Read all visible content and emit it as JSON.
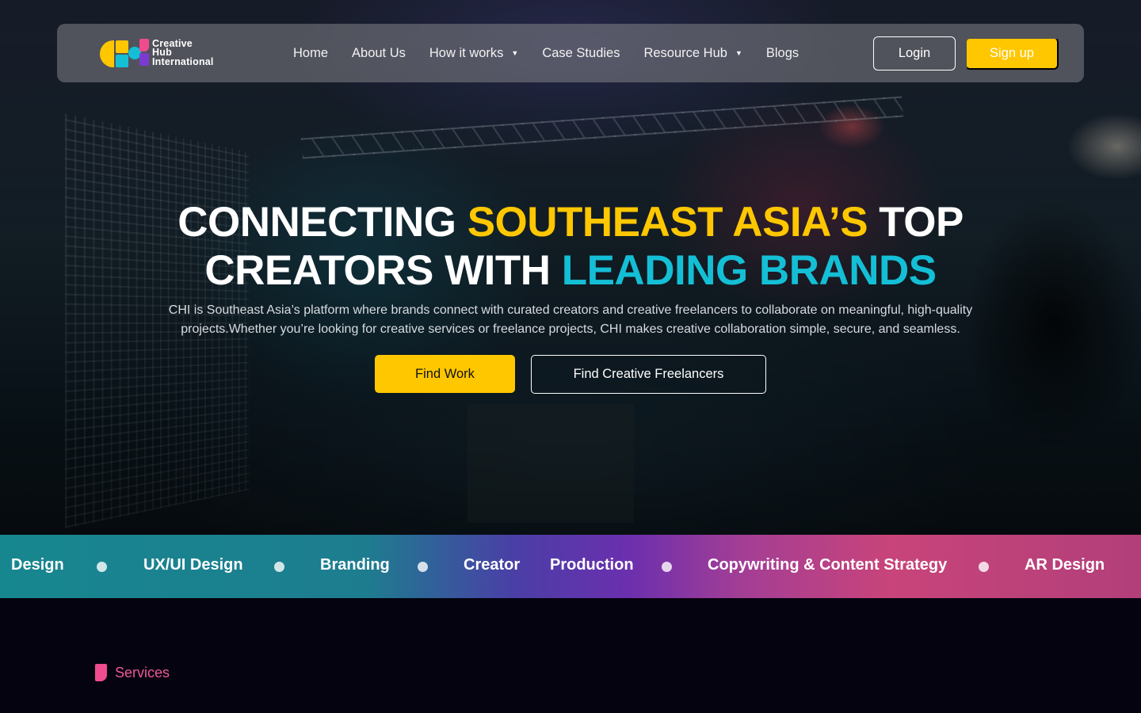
{
  "brand": {
    "name_line1": "Creative",
    "name_line2": "Hub",
    "name_line3": "International",
    "colors": {
      "yellow": "#ffc700",
      "cyan": "#14bfd6",
      "pink": "#ef4c8f",
      "purple": "#7b3bd1"
    }
  },
  "nav": {
    "items": [
      {
        "label": "Home",
        "has_dropdown": false
      },
      {
        "label": "About Us",
        "has_dropdown": false
      },
      {
        "label": "How it works",
        "has_dropdown": true
      },
      {
        "label": "Case Studies",
        "has_dropdown": false
      },
      {
        "label": "Resource Hub",
        "has_dropdown": true
      },
      {
        "label": "Blogs",
        "has_dropdown": false
      }
    ],
    "dropdown_glyph": "▼",
    "login_label": "Login",
    "signup_label": "Sign up"
  },
  "hero": {
    "headline": {
      "line1_a": "CONNECTING ",
      "line1_b": "SOUTHEAST ASIA’S",
      "line1_c": " TOP",
      "line2_a": "CREATORS WITH ",
      "line2_b": "LEADING BRANDS"
    },
    "subtext": "CHI is Southeast Asia’s platform where brands connect with curated creators and creative freelancers to collaborate on meaningful, high-quality projects.Whether you’re looking for creative services or freelance projects, CHI makes creative collaboration simple, secure, and seamless.",
    "primary_cta": "Find Work",
    "secondary_cta": "Find Creative Freelancers"
  },
  "marquee": {
    "items": [
      "Design",
      "UX/UI Design",
      "Branding",
      "Creator",
      "Production",
      "Copywriting & Content Strategy",
      "AR Design"
    ]
  },
  "services": {
    "label": "Services"
  }
}
